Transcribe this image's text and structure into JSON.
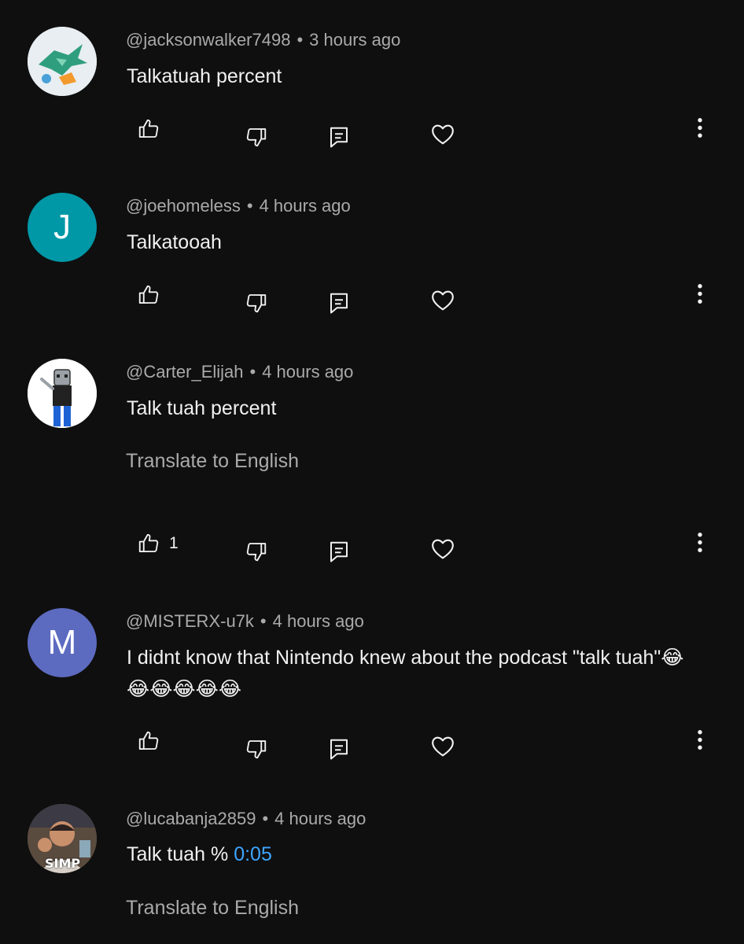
{
  "comments": [
    {
      "handle": "@jacksonwalker7498",
      "time": "3 hours ago",
      "text": "Talkatuah percent",
      "avatar_icon": "green-dragon-avatar",
      "likes": ""
    },
    {
      "handle": "@joehomeless",
      "time": "4 hours ago",
      "text": "Talkatooah",
      "avatar_letter": "J",
      "avatar_color": "#0097a7",
      "likes": ""
    },
    {
      "handle": "@Carter_Elijah",
      "time": "4 hours ago",
      "text": "Talk tuah percent",
      "translate": "Translate to English",
      "avatar_icon": "cartoon-character-avatar",
      "likes": "1"
    },
    {
      "handle": "@MISTERX-u7k",
      "time": "4 hours ago",
      "text": "I didnt know that Nintendo knew about the podcast \"talk tuah\"😂😂😂😂😂😂",
      "avatar_letter": "M",
      "avatar_color": "#5c6bc0",
      "likes": ""
    },
    {
      "handle": "@lucabanja2859",
      "time": "4 hours ago",
      "text": "Talk tuah % ",
      "timestamp_link": "0:05",
      "translate": "Translate to English",
      "avatar_icon": "photo-avatar",
      "avatar_caption": "SIMP",
      "likes": ""
    }
  ],
  "separator": "•",
  "colors": {
    "background": "#0f0f0f",
    "primary_text": "#f1f1f1",
    "secondary_text": "#aaaaaa",
    "link": "#3ea6ff"
  }
}
